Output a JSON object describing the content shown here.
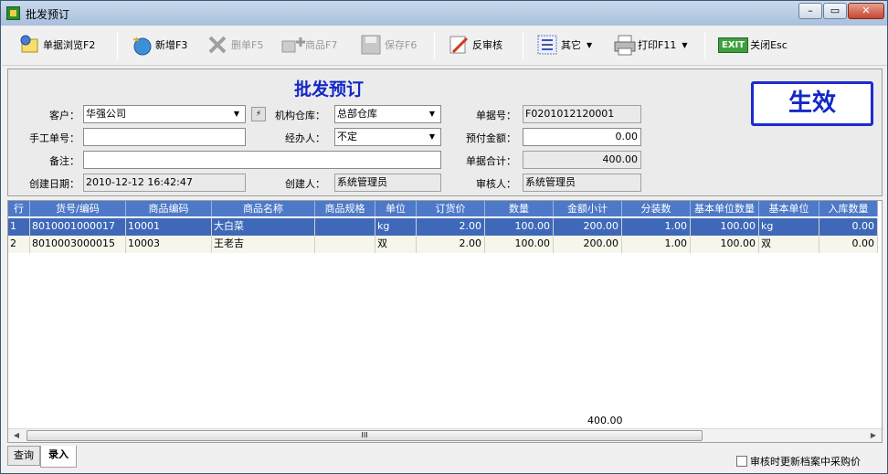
{
  "window": {
    "title": "批发预订",
    "controls": {
      "minimize": "–",
      "restore": "▭",
      "close": "✕"
    }
  },
  "toolbar": {
    "browse": "单据浏览F2",
    "new": "新增F3",
    "delete": "删单F5",
    "product": "商品F7",
    "save": "保存F6",
    "unapprove": "反审核",
    "other": "其它",
    "print": "打印F11",
    "exit_badge": "EXIT",
    "close": "关闭Esc"
  },
  "form": {
    "heading": "批发预订",
    "status": "生效",
    "customer_label": "客户：",
    "customer_value": "华强公司",
    "browse_btn": "⚡",
    "warehouse_label": "机构仓库：",
    "warehouse_value": "总部仓库",
    "doc_no_label": "单据号：",
    "doc_no_value": "F0201012120001",
    "manual_no_label": "手工单号：",
    "manual_no_value": "",
    "handler_label": "经办人：",
    "handler_value": "不定",
    "prepay_label": "预付金额：",
    "prepay_value": "0.00",
    "note_label": "备注：",
    "note_value": "",
    "total_label": "单据合计：",
    "total_value": "400.00",
    "created_date_label": "创建日期：",
    "created_date_value": "2010-12-12 16:42:47",
    "creator_label": "创建人：",
    "creator_value": "系统管理员",
    "reviewer_label": "审核人：",
    "reviewer_value": "系统管理员"
  },
  "grid": {
    "columns": [
      "行",
      "货号/编码",
      "商品编码",
      "商品名称",
      "商品规格",
      "单位",
      "订货价",
      "数量",
      "金额小计",
      "分装数",
      "基本单位数量",
      "基本单位",
      "入库数量"
    ],
    "rows": [
      [
        "1",
        "8010001000017",
        "10001",
        "大白菜",
        "",
        "kg",
        "2.00",
        "100.00",
        "200.00",
        "1.00",
        "100.00",
        "kg",
        "0.00"
      ],
      [
        "2",
        "8010003000015",
        "10003",
        "王老吉",
        "",
        "双",
        "2.00",
        "100.00",
        "200.00",
        "1.00",
        "100.00",
        "双",
        "0.00"
      ]
    ],
    "footer_total": "400.00",
    "scroll": {
      "left": "◀",
      "grip": "III",
      "right": "▶"
    }
  },
  "tabs": [
    "查询",
    "录入"
  ],
  "checkbox_label": "审核时更新档案中采购价",
  "colors": {
    "title_blue": "#1428c8",
    "header_bg": "#4d79c8",
    "selected_row": "#3f69b8"
  }
}
